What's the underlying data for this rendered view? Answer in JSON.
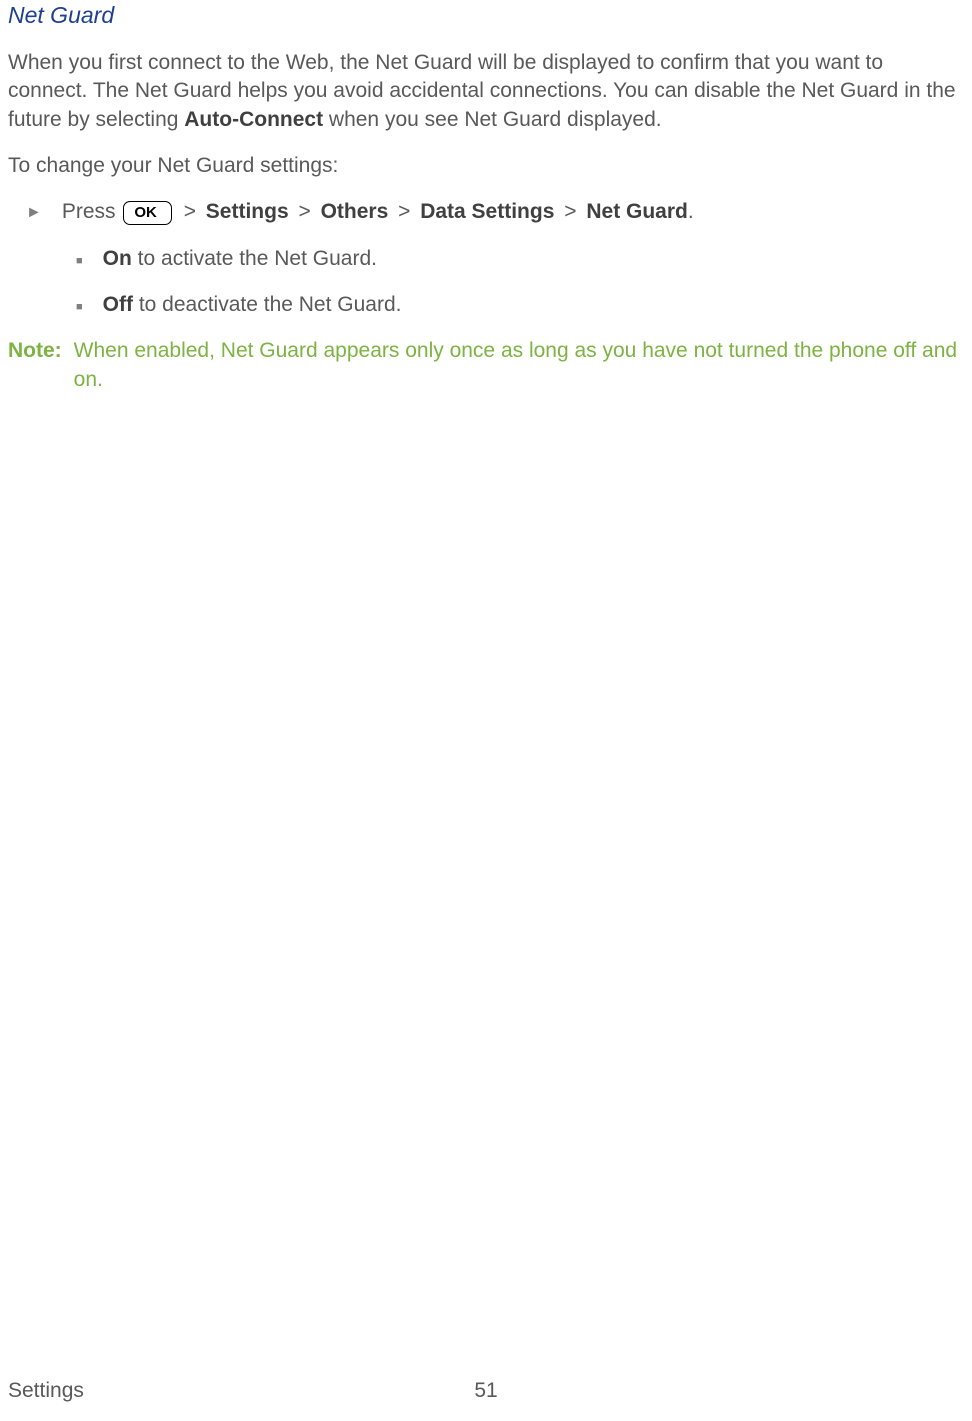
{
  "section_title": "Net Guard",
  "intro_part1": "When you first connect to the Web, the Net Guard will be displayed to confirm that you want to connect. The Net Guard helps you avoid accidental connections. You can disable the Net Guard in the future by selecting ",
  "intro_bold": "Auto-Connect",
  "intro_part2": " when you see Net Guard displayed.",
  "change_text": "To change your Net Guard settings:",
  "press_label": "Press ",
  "ok_label": "OK",
  "crumb_sep": " > ",
  "crumbs": {
    "settings": "Settings",
    "others": "Others",
    "data_settings": "Data Settings",
    "net_guard": "Net Guard"
  },
  "period": ".",
  "bullets": {
    "on_bold": "On",
    "on_text": " to activate the Net Guard.",
    "off_bold": "Off",
    "off_text": " to deactivate the Net Guard."
  },
  "note_label": "Note:",
  "note_text": "When enabled, Net Guard appears only once as long as you have not turned the phone off and on.",
  "footer_section": "Settings",
  "footer_page": "51"
}
